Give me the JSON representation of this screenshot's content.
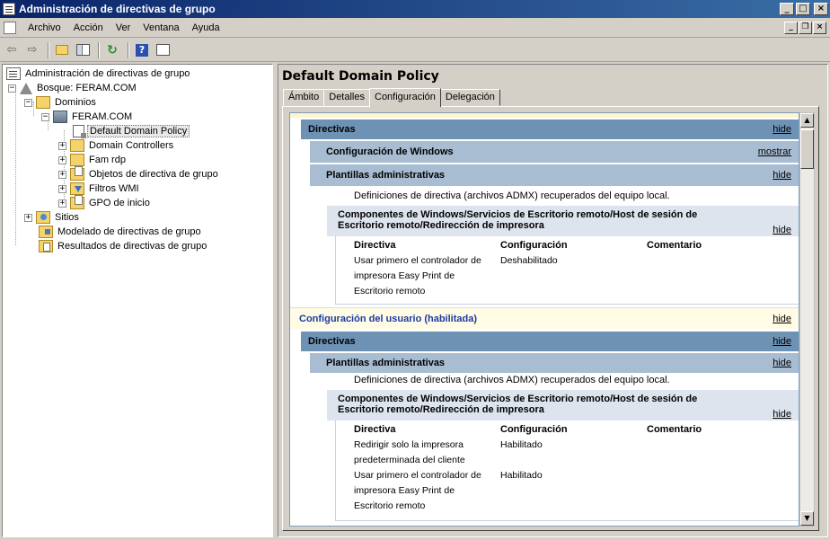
{
  "window": {
    "title": "Administración de directivas de grupo"
  },
  "menu": {
    "items": [
      "Archivo",
      "Acción",
      "Ver",
      "Ventana",
      "Ayuda"
    ]
  },
  "tree": {
    "root": "Administración de directivas de grupo",
    "forest": "Bosque: FERAM.COM",
    "domains": "Dominios",
    "domain": "FERAM.COM",
    "selected": "Default Domain Policy",
    "children": [
      "Domain Controllers",
      "Fam rdp",
      "Objetos de directiva de grupo",
      "Filtros WMI",
      "GPO de inicio"
    ],
    "sites": "Sitios",
    "modeling": "Modelado de directivas de grupo",
    "results": "Resultados de directivas de grupo"
  },
  "policy": {
    "title": "Default Domain Policy",
    "tabs": [
      "Ámbito",
      "Detalles",
      "Configuración",
      "Delegación"
    ],
    "active_tab": "Configuración"
  },
  "report": {
    "hide": "hide",
    "show": "mostrar",
    "computer": {
      "directivas": "Directivas",
      "windows_config": "Configuración de Windows",
      "admin_templates": "Plantillas administrativas",
      "admx_note": "Definiciones de directiva (archivos ADMX) recuperados del equipo local.",
      "component_title_1": "Componentes de Windows/Servicios de Escritorio remoto/Host de sesión de",
      "component_title_2": "Escritorio remoto/Redirección de impresora",
      "col_policy": "Directiva",
      "col_setting": "Configuración",
      "col_comment": "Comentario",
      "rows": [
        {
          "policy_lines": [
            "Usar primero el controlador de",
            "impresora Easy Print de",
            "Escritorio remoto"
          ],
          "setting": "Deshabilitado"
        }
      ]
    },
    "user": {
      "header": "Configuración del usuario (habilitada)",
      "directivas": "Directivas",
      "admin_templates": "Plantillas administrativas",
      "admx_note": "Definiciones de directiva (archivos ADMX) recuperados del equipo local.",
      "component_title_1": "Componentes de Windows/Servicios de Escritorio remoto/Host de sesión de",
      "component_title_2": "Escritorio remoto/Redirección de impresora",
      "col_policy": "Directiva",
      "col_setting": "Configuración",
      "col_comment": "Comentario",
      "rows": [
        {
          "policy_lines": [
            "Redirigir solo la impresora",
            "predeterminada del cliente"
          ],
          "setting": "Habilitado"
        },
        {
          "policy_lines": [
            "Usar primero el controlador de",
            "impresora Easy Print de",
            "Escritorio remoto"
          ],
          "setting": "Habilitado"
        }
      ]
    }
  }
}
